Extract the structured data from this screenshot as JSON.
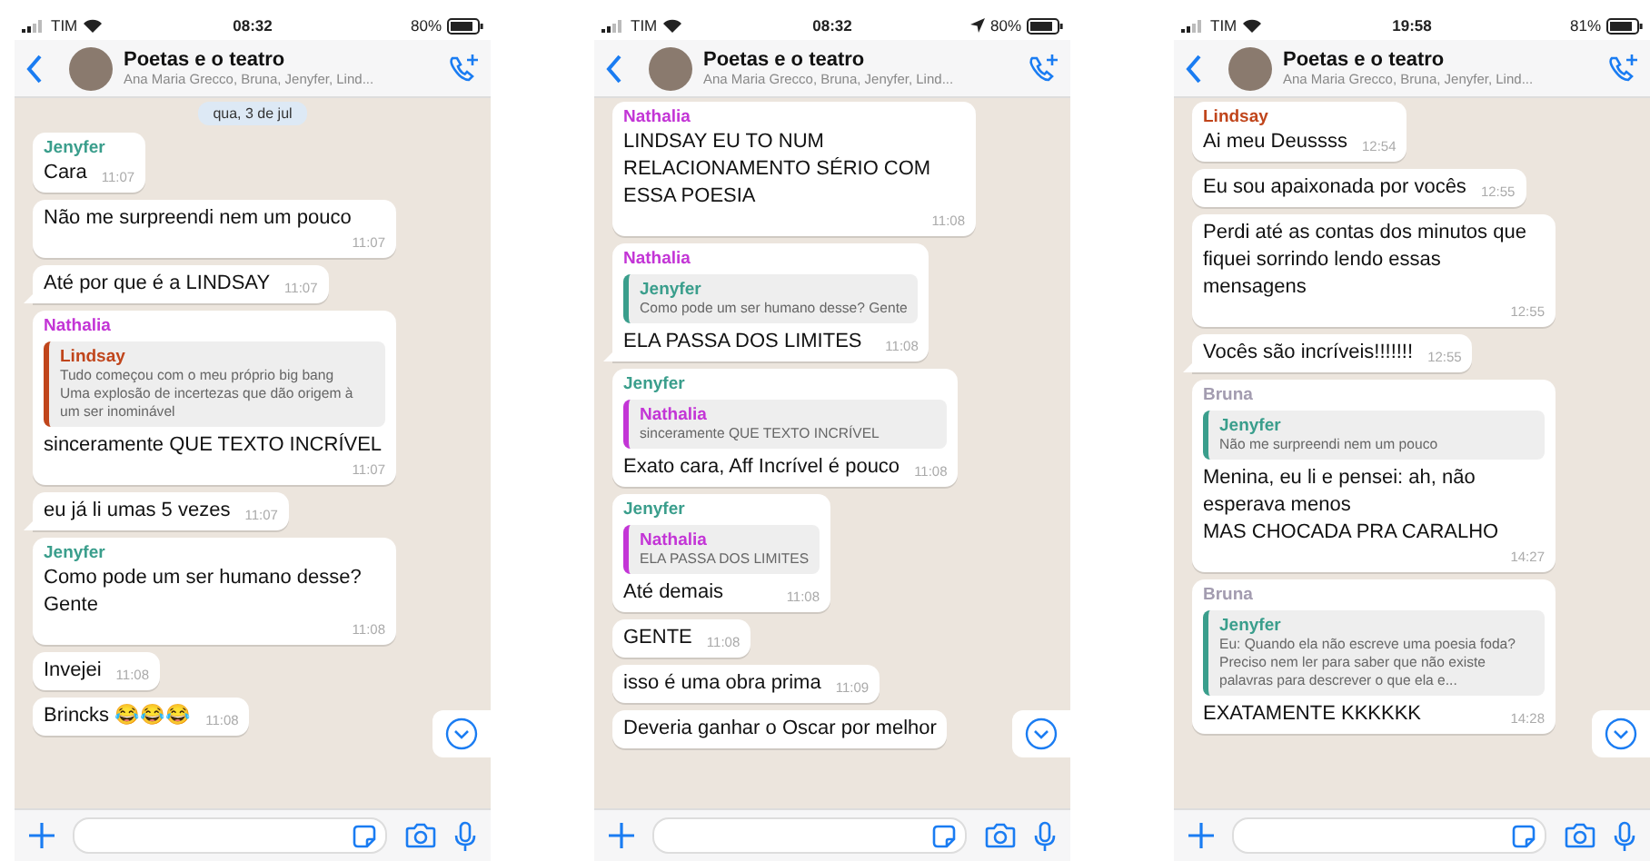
{
  "screens": [
    {
      "status": {
        "carrier": "TIM",
        "time": "08:32",
        "location": false,
        "battery": "80%"
      },
      "header": {
        "title": "Poetas e o teatro",
        "subtitle": "Ana Maria Grecco, Bruna, Jenyfer, Lind..."
      },
      "date_chip": "qua, 3 de jul",
      "messages": [
        {
          "sender": "Jenyfer",
          "color": "#3a9e8c",
          "text": "Cara",
          "time": "11:07",
          "tail": false
        },
        {
          "text": "Não me surpreendi nem um pouco",
          "time": "11:07",
          "tail": false
        },
        {
          "text": "Até por que é a LINDSAY",
          "time": "11:07",
          "tail": true
        },
        {
          "sender": "Nathalia",
          "color": "#c335d6",
          "quote": {
            "author": "Lindsay",
            "color": "#c0451b",
            "text": "Tudo começou com o meu próprio big bang\nUma explosão de incertezas que dão origem à um ser  inominável"
          },
          "text": "sinceramente QUE TEXTO INCRÍVEL",
          "time": "11:07",
          "tail": false
        },
        {
          "text": "eu já li umas 5 vezes",
          "time": "11:07",
          "tail": true
        },
        {
          "sender": "Jenyfer",
          "color": "#3a9e8c",
          "text": "Como pode um ser humano desse?\nGente",
          "time": "11:08",
          "tail": false
        },
        {
          "text": "Invejei",
          "time": "11:08",
          "tail": false
        },
        {
          "text": "Brincks 😂😂😂",
          "time": "11:08",
          "tail": false
        }
      ]
    },
    {
      "status": {
        "carrier": "TIM",
        "time": "08:32",
        "location": true,
        "battery": "80%"
      },
      "header": {
        "title": "Poetas e o teatro",
        "subtitle": "Ana Maria Grecco, Bruna, Jenyfer, Lind..."
      },
      "messages": [
        {
          "sender": "Nathalia",
          "color": "#c335d6",
          "text": "LINDSAY EU TO NUM RELACIONAMENTO SÉRIO COM ESSA POESIA",
          "time": "11:08",
          "tail": false
        },
        {
          "sender": "Nathalia",
          "color": "#c335d6",
          "quote": {
            "author": "Jenyfer",
            "color": "#3a9e8c",
            "text": "Como pode um ser humano desse? Gente"
          },
          "text": "ELA PASSA DOS LIMITES",
          "time": "11:08",
          "tail": true
        },
        {
          "sender": "Jenyfer",
          "color": "#3a9e8c",
          "quote": {
            "author": "Nathalia",
            "color": "#c335d6",
            "text": "sinceramente QUE TEXTO INCRÍVEL"
          },
          "text": "Exato cara, Aff Incrível é pouco",
          "time": "11:08",
          "tail": false
        },
        {
          "sender": "Jenyfer",
          "color": "#3a9e8c",
          "quote": {
            "author": "Nathalia",
            "color": "#c335d6",
            "text": "ELA PASSA DOS LIMITES"
          },
          "text": "Até demais",
          "time": "11:08",
          "tail": false
        },
        {
          "text": "GENTE",
          "time": "11:08",
          "tail": false
        },
        {
          "text": "isso é uma obra prima",
          "time": "11:09",
          "tail": false
        },
        {
          "text": "Deveria ganhar o Oscar por melhor",
          "tail": false
        }
      ]
    },
    {
      "status": {
        "carrier": "TIM",
        "time": "19:58",
        "location": false,
        "battery": "81%"
      },
      "header": {
        "title": "Poetas e o teatro",
        "subtitle": "Ana Maria Grecco, Bruna, Jenyfer, Lind..."
      },
      "messages": [
        {
          "sender": "Lindsay",
          "color": "#c0451b",
          "text": "Ai meu Deussss",
          "time": "12:54",
          "tail": false
        },
        {
          "text": "Eu sou apaixonada por vocês",
          "time": "12:55",
          "tail": false
        },
        {
          "text": "Perdi até as contas dos minutos que fiquei sorrindo lendo essas mensagens",
          "time": "12:55",
          "tail": false
        },
        {
          "text": "Vocês são incríveis!!!!!!!",
          "time": "12:55",
          "tail": true
        },
        {
          "sender": "Bruna",
          "color": "#a39cb0",
          "quote": {
            "author": "Jenyfer",
            "color": "#3a9e8c",
            "text": "Não me surpreendi nem um pouco"
          },
          "text": "Menina, eu li e pensei: ah, não esperava menos\nMAS CHOCADA PRA CARALHO",
          "time": "14:27",
          "tail": false
        },
        {
          "sender": "Bruna",
          "color": "#a39cb0",
          "quote": {
            "author": "Jenyfer",
            "color": "#3a9e8c",
            "text": "Eu: Quando ela não escreve uma poesia foda? Preciso nem ler para saber que não existe palavras para descrever o que ela e..."
          },
          "text": "EXATAMENTE KKKKKK",
          "time": "14:28",
          "tail": false
        }
      ]
    }
  ]
}
